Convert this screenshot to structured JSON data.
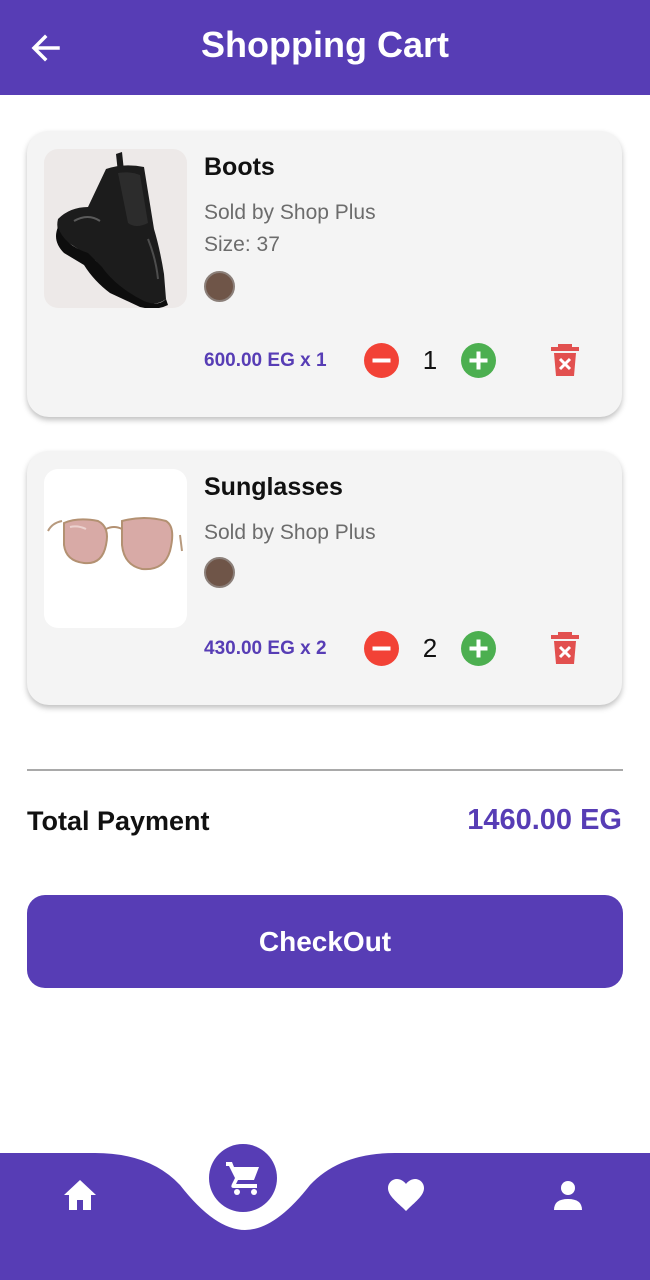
{
  "header": {
    "title": "Shopping Cart",
    "back_icon": "arrow-left-icon"
  },
  "cart": {
    "items": [
      {
        "name": "Boots",
        "seller": "Sold by Shop Plus",
        "size": "Size: 37",
        "color": "#6f5548",
        "price": "600.00 EG x 1",
        "quantity": "1",
        "image": "boot-image"
      },
      {
        "name": "Sunglasses",
        "seller": "Sold by Shop Plus",
        "color": "#6f5548",
        "price": "430.00 EG x 2",
        "quantity": "2",
        "image": "sunglasses-image"
      }
    ]
  },
  "summary": {
    "total_label": "Total Payment",
    "total_value": "1460.00 EG"
  },
  "checkout": {
    "label": "CheckOut"
  },
  "bottom_nav": {
    "items": [
      "home-icon",
      "cart-icon",
      "heart-icon",
      "person-icon"
    ],
    "active": "cart-icon"
  },
  "colors": {
    "primary": "#573db5",
    "minus": "#f24236",
    "plus": "#4caf50",
    "delete": "#e2504f"
  }
}
